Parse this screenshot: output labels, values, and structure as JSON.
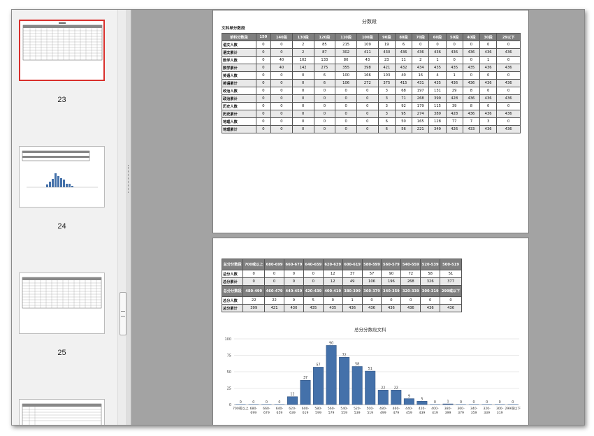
{
  "thumbnails": [
    {
      "number": "23",
      "selected": true
    },
    {
      "number": "24",
      "selected": false
    },
    {
      "number": "25",
      "selected": false
    }
  ],
  "page1": {
    "title": "分数段",
    "subtitle": "文科单分数段",
    "headers": [
      "单科分数段",
      "150",
      "140段",
      "130段",
      "120段",
      "110段",
      "100段",
      "90段",
      "80段",
      "70段",
      "60段",
      "50段",
      "40段",
      "30段",
      "29以下"
    ],
    "rows": [
      {
        "label": "语文人数",
        "values": [
          "0",
          "0",
          "2",
          "85",
          "215",
          "109",
          "19",
          "6",
          "0",
          "0",
          "0",
          "0",
          "0",
          "0"
        ]
      },
      {
        "label": "语文累计",
        "values": [
          "0",
          "0",
          "2",
          "87",
          "302",
          "411",
          "430",
          "436",
          "436",
          "436",
          "436",
          "436",
          "436",
          "436"
        ]
      },
      {
        "label": "数学人数",
        "values": [
          "0",
          "40",
          "102",
          "133",
          "80",
          "43",
          "23",
          "11",
          "2",
          "1",
          "0",
          "0",
          "1",
          "0"
        ]
      },
      {
        "label": "数学累计",
        "values": [
          "0",
          "40",
          "142",
          "275",
          "355",
          "398",
          "421",
          "432",
          "434",
          "435",
          "435",
          "435",
          "436",
          "436"
        ]
      },
      {
        "label": "英语人数",
        "values": [
          "0",
          "0",
          "0",
          "6",
          "100",
          "166",
          "103",
          "40",
          "16",
          "4",
          "1",
          "0",
          "0",
          "0"
        ]
      },
      {
        "label": "英语累计",
        "values": [
          "0",
          "0",
          "0",
          "6",
          "106",
          "272",
          "375",
          "415",
          "431",
          "435",
          "436",
          "436",
          "436",
          "436"
        ]
      },
      {
        "label": "政治人数",
        "values": [
          "0",
          "0",
          "0",
          "0",
          "0",
          "0",
          "3",
          "68",
          "197",
          "131",
          "29",
          "8",
          "0",
          "0"
        ]
      },
      {
        "label": "政治累计",
        "values": [
          "0",
          "0",
          "0",
          "0",
          "0",
          "0",
          "3",
          "71",
          "268",
          "399",
          "428",
          "436",
          "436",
          "436"
        ]
      },
      {
        "label": "历史人数",
        "values": [
          "0",
          "0",
          "0",
          "0",
          "0",
          "0",
          "3",
          "92",
          "179",
          "115",
          "39",
          "8",
          "0",
          "0"
        ]
      },
      {
        "label": "历史累计",
        "values": [
          "0",
          "0",
          "0",
          "0",
          "0",
          "0",
          "3",
          "95",
          "274",
          "389",
          "428",
          "436",
          "436",
          "436"
        ]
      },
      {
        "label": "地理人数",
        "values": [
          "0",
          "0",
          "0",
          "0",
          "0",
          "0",
          "6",
          "50",
          "165",
          "128",
          "77",
          "7",
          "3",
          "0"
        ]
      },
      {
        "label": "地理累计",
        "values": [
          "0",
          "0",
          "0",
          "0",
          "0",
          "0",
          "6",
          "56",
          "221",
          "349",
          "426",
          "433",
          "436",
          "436"
        ]
      }
    ]
  },
  "page2": {
    "blocks": [
      {
        "header": [
          "总分分数段",
          "700或以上",
          "680-699",
          "660-679",
          "640-659",
          "620-639",
          "600-619",
          "580-599",
          "560-579",
          "540-559",
          "520-539",
          "500-519"
        ],
        "rows": [
          {
            "label": "总分人数",
            "values": [
              "0",
              "0",
              "0",
              "0",
              "12",
              "37",
              "57",
              "90",
              "72",
              "58",
              "51"
            ]
          },
          {
            "label": "总分累计",
            "values": [
              "0",
              "0",
              "0",
              "0",
              "12",
              "49",
              "106",
              "196",
              "268",
              "326",
              "377"
            ]
          }
        ]
      },
      {
        "header": [
          "总分分数段",
          "480-499",
          "460-479",
          "440-459",
          "420-439",
          "400-419",
          "380-399",
          "360-379",
          "340-359",
          "320-339",
          "300-319",
          "299或以下"
        ],
        "rows": [
          {
            "label": "总分人数",
            "values": [
              "22",
              "22",
              "9",
              "5",
              "0",
              "1",
              "0",
              "0",
              "0",
              "0",
              "0"
            ]
          },
          {
            "label": "总分累计",
            "values": [
              "399",
              "421",
              "430",
              "435",
              "435",
              "436",
              "436",
              "436",
              "436",
              "436",
              "436"
            ]
          }
        ]
      }
    ]
  },
  "chart_data": {
    "type": "bar",
    "title": "总分分数段文科",
    "categories": [
      "700或以上",
      "680-699",
      "660-679",
      "640-659",
      "620-639",
      "600-619",
      "580-599",
      "560-579",
      "540-559",
      "520-539",
      "500-519",
      "480-499",
      "460-479",
      "440-459",
      "420-439",
      "400-419",
      "380-399",
      "360-379",
      "340-359",
      "320-339",
      "300-319",
      "299或以下"
    ],
    "values": [
      0,
      0,
      0,
      0,
      12,
      37,
      57,
      90,
      72,
      58,
      51,
      22,
      22,
      9,
      5,
      0,
      1,
      0,
      0,
      0,
      0,
      0
    ],
    "ylim": [
      0,
      100
    ],
    "yticks": [
      0,
      25,
      50,
      75,
      100
    ],
    "grid": true,
    "bar_color": "#4471aa",
    "xlabel": "",
    "ylabel": ""
  },
  "colors": {
    "workspace": "#a3a3a3",
    "selection": "#d9302c",
    "table_header": "#7f7f7f"
  }
}
